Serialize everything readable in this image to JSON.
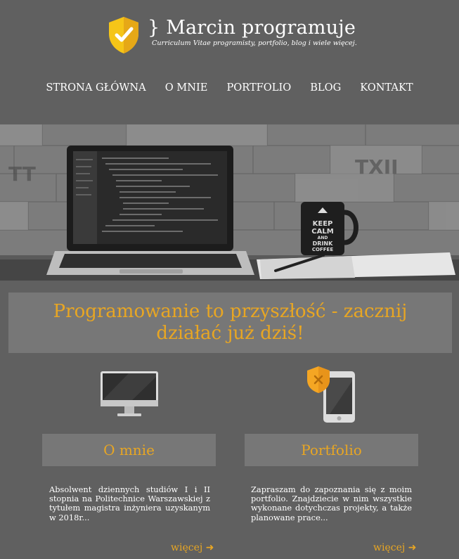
{
  "header": {
    "brace": "}",
    "title": "Marcin programuje",
    "subtitle": "Curriculum Vitae programisty, portfolio, blog i wiele więcej."
  },
  "nav": {
    "items": [
      {
        "label": "STRONA GŁÓWNA"
      },
      {
        "label": "O MNIE"
      },
      {
        "label": "PORTFOLIO"
      },
      {
        "label": "BLOG"
      },
      {
        "label": "KONTAKT"
      }
    ]
  },
  "hero": {
    "mug_text": [
      "KEEP",
      "CALM",
      "AND",
      "DRINK",
      "COFFEE"
    ]
  },
  "banner": {
    "headline": "Programowanie to przyszłość - zacznij działać już dziś!"
  },
  "features": [
    {
      "icon": "monitor-icon",
      "title": "O mnie",
      "description": "Absolwent dziennych studiów I i II stopnia na Politechnice Warszawskiej z tytułem magistra inżyniera uzyskanym w 2018r...",
      "more_label": "więcej ➜"
    },
    {
      "icon": "tablet-shield-icon",
      "title": "Portfolio",
      "description": "Zapraszam do zapoznania się z moim portfolio. Znajdziecie w nim wszystkie wykonane dotychczas projekty, a także planowane prace...",
      "more_label": "więcej ➜"
    }
  ],
  "colors": {
    "background": "#606060",
    "panel": "#777777",
    "accent": "#e8a623",
    "shield": "#f5c518"
  }
}
